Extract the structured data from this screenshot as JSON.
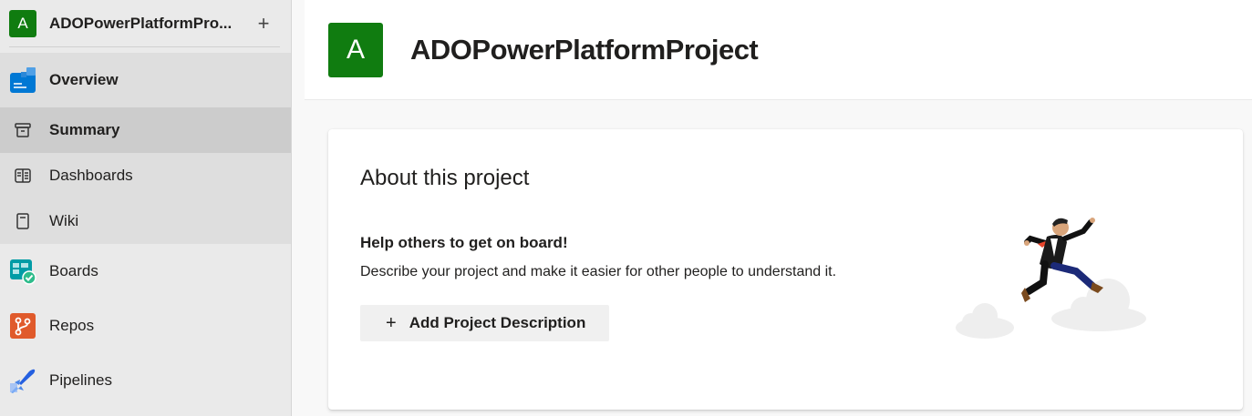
{
  "sidebar": {
    "project_initial": "A",
    "project_name": "ADOPowerPlatformPro...",
    "add_label": "+",
    "items": {
      "overview": "Overview",
      "summary": "Summary",
      "dashboards": "Dashboards",
      "wiki": "Wiki",
      "boards": "Boards",
      "repos": "Repos",
      "pipelines": "Pipelines"
    }
  },
  "header": {
    "initial": "A",
    "title": "ADOPowerPlatformProject"
  },
  "card": {
    "title": "About this project",
    "help_title": "Help others to get on board!",
    "help_desc": "Describe your project and make it easier for other people to understand it.",
    "add_button_plus": "+",
    "add_button_label": "Add Project Description"
  },
  "colors": {
    "project_avatar": "#107c10",
    "sidebar_bg": "#eaeaea",
    "selected_bg": "#cccccc"
  }
}
